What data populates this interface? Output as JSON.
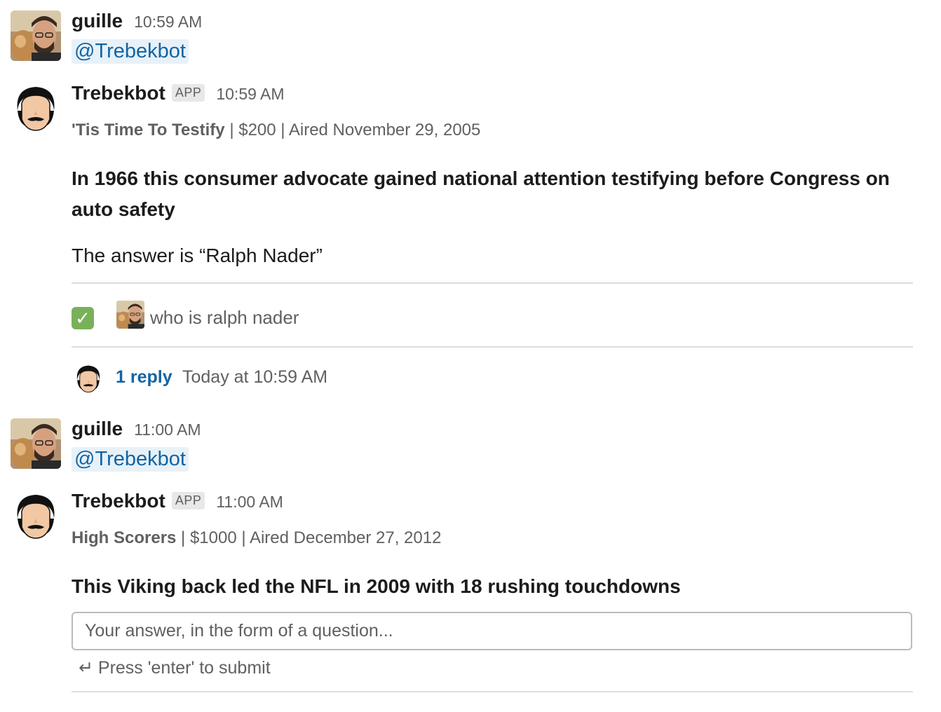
{
  "messages": [
    {
      "sender": "guille",
      "time": "10:59 AM",
      "mention": "@Trebekbot"
    },
    {
      "sender": "Trebekbot",
      "badge": "APP",
      "time": "10:59 AM",
      "category": "'Tis Time To Testify",
      "details": " | $200 | Aired November 29, 2005",
      "clue": "In 1966 this consumer advocate gained national attention testifying before Congress on auto safety",
      "answer": "The answer is “Ralph Nader”",
      "result_icon": "white-check-mark",
      "guess": "who is ralph nader",
      "reply_count": "1 reply",
      "reply_time": "Today at 10:59 AM"
    },
    {
      "sender": "guille",
      "time": "11:00 AM",
      "mention": "@Trebekbot"
    },
    {
      "sender": "Trebekbot",
      "badge": "APP",
      "time": "11:00 AM",
      "category": "High Scorers",
      "details": " | $1000 | Aired December 27, 2012",
      "clue": "This Viking back led the NFL in 2009 with 18 rushing touchdowns",
      "input_placeholder": "Your answer, in the form of a question...",
      "input_value": "",
      "submit_hint": "↵ Press 'enter' to submit"
    }
  ],
  "colors": {
    "link": "#1264a3",
    "mention_bg": "#e8f1f8",
    "muted": "#616061",
    "check": "#78b159"
  }
}
